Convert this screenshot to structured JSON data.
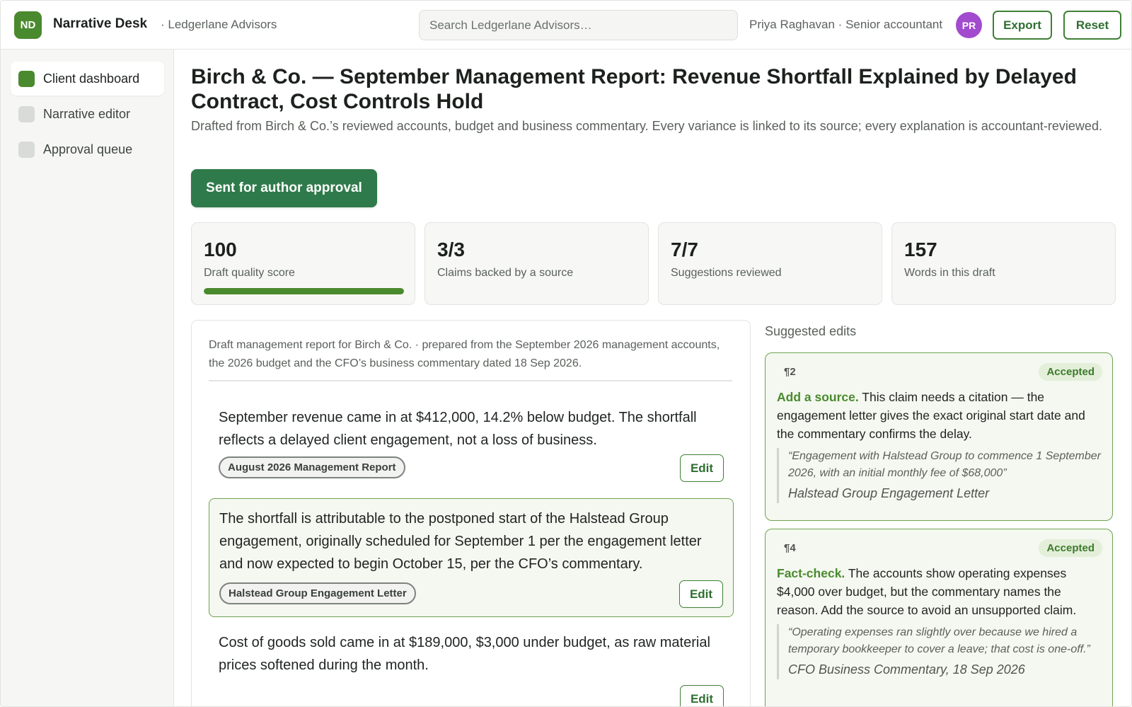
{
  "header": {
    "logo_text": "ND",
    "app_name": "Narrative Desk",
    "org_name": "· Ledgerlane Advisors",
    "search_placeholder": "Search Ledgerlane Advisors…",
    "user_info": "Priya Raghavan · Senior accountant",
    "avatar_initials": "PR",
    "export_label": "Export",
    "reset_label": "Reset"
  },
  "sidebar": {
    "items": [
      {
        "label": "Client dashboard",
        "active": true
      },
      {
        "label": "Narrative editor",
        "active": false
      },
      {
        "label": "Approval queue",
        "active": false
      }
    ]
  },
  "main": {
    "title": "Birch & Co. — September Management Report: Revenue Shortfall Explained by Delayed Contract, Cost Controls Hold",
    "subtitle": "Drafted from Birch & Co.’s reviewed accounts, budget and business commentary. Every variance is linked to its source; every explanation is accountant-reviewed.",
    "status_button": "Sent for author approval",
    "stats": [
      {
        "value": "100",
        "label": "Draft quality score",
        "progress": 1.0
      },
      {
        "value": "3/3",
        "label": "Claims backed by a source"
      },
      {
        "value": "7/7",
        "label": "Suggestions reviewed"
      },
      {
        "value": "157",
        "label": "Words in this draft"
      }
    ]
  },
  "draft": {
    "intro": "Draft management report for Birch & Co. · prepared from the September 2026 management accounts, the 2026 budget and the CFO’s business commentary dated 18 Sep 2026.",
    "edit_label": "Edit",
    "paragraphs": [
      {
        "text": "September revenue came in at $412,000, 14.2% below budget. The shortfall reflects a delayed client engagement, not a loss of business.",
        "source": "August 2026 Management Report",
        "highlighted": false
      },
      {
        "text": "The shortfall is attributable to the postponed start of the Halstead Group engagement, originally scheduled for September 1 per the engagement letter and now expected to begin October 15, per the CFO’s commentary.",
        "source": "Halstead Group Engagement Letter",
        "highlighted": true
      },
      {
        "text": "Cost of goods sold came in at $189,000, $3,000 under budget, as raw material prices softened during the month.",
        "source": "",
        "highlighted": false
      }
    ]
  },
  "suggestions": {
    "heading": "Suggested edits",
    "items": [
      {
        "ref": "¶2",
        "status": "Accepted",
        "kind": "Add a source.",
        "body": "This claim needs a citation — the engagement letter gives the exact original start date and the commentary confirms the delay.",
        "quote": "“Engagement with Halstead Group to commence 1 September 2026, with an initial monthly fee of $68,000”",
        "quote_source": "Halstead Group Engagement Letter"
      },
      {
        "ref": "¶4",
        "status": "Accepted",
        "kind": "Fact-check.",
        "body": "The accounts show operating expenses $4,000 over budget, but the commentary names the reason. Add the source to avoid an unsupported claim.",
        "quote": "“Operating expenses ran slightly over because we hired a temporary bookkeeper to cover a leave; that cost is one-off.”",
        "quote_source": "CFO Business Commentary, 18 Sep 2026"
      }
    ]
  },
  "colors": {
    "brand_green": "#4a8a2e",
    "status_green": "#2f7a4a",
    "avatar_purple": "#a24bcf"
  }
}
